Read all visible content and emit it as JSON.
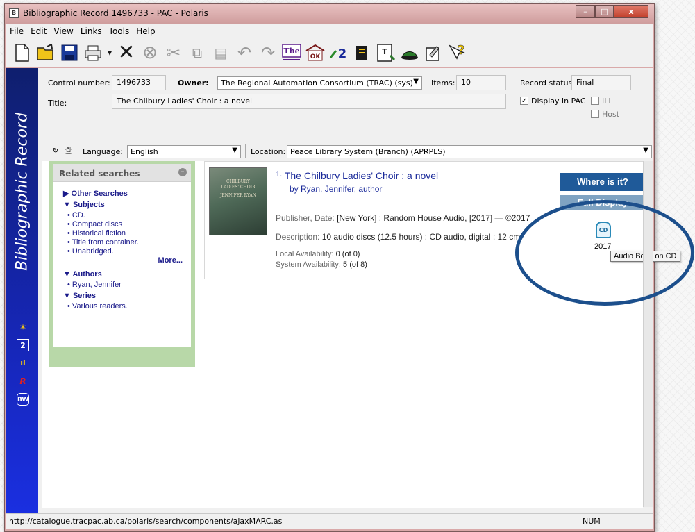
{
  "window": {
    "title": "Bibliographic Record 1496733 - PAC - Polaris",
    "title_icon": "B",
    "controls": {
      "minimize": "–",
      "maximize": "□",
      "close": "x"
    }
  },
  "menu": [
    "File",
    "Edit",
    "View",
    "Links",
    "Tools",
    "Help"
  ],
  "toolbar_icons": [
    "new-icon",
    "open-icon",
    "save-icon",
    "print-icon",
    "print-dropdown-icon",
    "delete-icon",
    "cancel-icon",
    "cut-icon",
    "copy-icon",
    "paste-icon",
    "undo-icon",
    "redo-icon",
    "thesaurus-icon",
    "validate-icon",
    "link-icon",
    "count-icon",
    "record-icon",
    "hat-icon",
    "properties-icon",
    "help-icon"
  ],
  "sidebar": {
    "title": "Bibliographic Record"
  },
  "record": {
    "control_number_label": "Control number:",
    "control_number": "1496733",
    "owner_label": "Owner:",
    "owner": "The Regional Automation Consortium (TRAC) (sys)",
    "items_label": "Items:",
    "items": "10",
    "status_label": "Record status:",
    "status": "Final",
    "title_label": "Title:",
    "title": "The Chilbury Ladies' Choir : a novel",
    "display_pac_label": "Display in PAC",
    "display_pac_checked": true,
    "ill_label": "ILL",
    "host_label": "Host"
  },
  "langbar": {
    "language_label": "Language:",
    "language": "English",
    "location_label": "Location:",
    "location": "Peace Library System (Branch) (APRPLS)"
  },
  "related": {
    "header": "Related searches",
    "other_searches": "Other Searches",
    "subjects_header": "Subjects",
    "subjects": [
      "CD.",
      "Compact discs",
      "Historical fiction",
      "Title from container.",
      "Unabridged."
    ],
    "more": "More...",
    "authors_header": "Authors",
    "authors": [
      "Ryan, Jennifer"
    ],
    "series_header": "Series",
    "series": [
      "Various readers."
    ]
  },
  "result": {
    "number": "1.",
    "title": "The Chilbury Ladies' Choir : a novel",
    "by": "by Ryan, Jennifer, author",
    "publisher_label": "Publisher, Date: ",
    "publisher": "[New York] : Random House Audio, [2017] — ©2017",
    "description_label": "Description: ",
    "description": "10 audio discs (12.5 hours) : CD audio, digital ; 12 cm.",
    "local_label": "Local Availability: ",
    "local": "0 (of 0)",
    "system_label": "System Availability: ",
    "system": "5 (of 8)",
    "where_btn": "Where is it?",
    "full_btn": "Full Display",
    "format_icon_text": "CD",
    "year": "2017",
    "tooltip": "Audio Book on CD",
    "cover_lines": [
      "CHILBURY",
      "LADIES' CHOIR",
      "JENNIFER RYAN"
    ]
  },
  "status": {
    "url": "http://catalogue.tracpac.ab.ca/polaris/search/components/ajaxMARC.as",
    "num": "NUM"
  }
}
